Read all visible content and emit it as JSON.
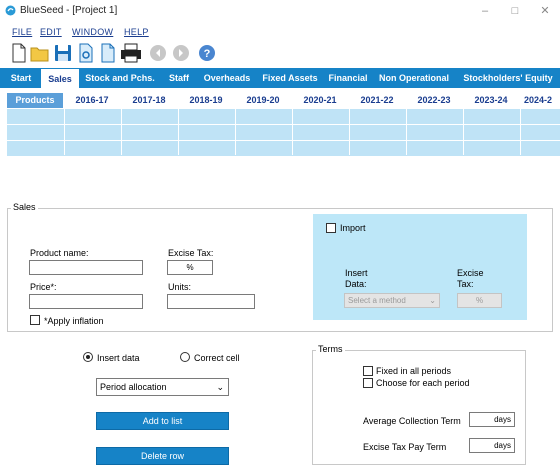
{
  "window": {
    "title": "BlueSeed - [Project 1]"
  },
  "menu": {
    "items": [
      "FILE",
      "EDIT",
      "WINDOW",
      "HELP"
    ]
  },
  "toolbar": {
    "icons": [
      "new-file-icon",
      "open-folder-icon",
      "save-icon",
      "settings-file-icon",
      "document-icon",
      "print-icon",
      "back-icon",
      "forward-icon",
      "help-icon"
    ]
  },
  "tabs": [
    "Start",
    "Sales",
    "Stock and Pchs.",
    "Staff",
    "Overheads",
    "Fixed Assets",
    "Financial",
    "Non Operational",
    "Stockholders' Equity"
  ],
  "active_tab": "Sales",
  "grid": {
    "columns": [
      "Products",
      "2016-17",
      "2017-18",
      "2018-19",
      "2019-20",
      "2020-21",
      "2021-22",
      "2022-23",
      "2023-24",
      "2024-2"
    ]
  },
  "sales": {
    "legend": "Sales",
    "product_name_label": "Product name:",
    "excise_tax_label": "Excise Tax:",
    "excise_tax_unit": "%",
    "price_label": "Price*:",
    "units_label": "Units:",
    "apply_inflation_label": "*Apply inflation",
    "import_label": "Import",
    "insert_data_label": "Insert\nData:",
    "insert_data_line1": "Insert",
    "insert_data_line2": "Data:",
    "import_excise_line1": "Excise",
    "import_excise_line2": "Tax:",
    "method_placeholder": "Select a method",
    "import_excise_unit": "%"
  },
  "mode": {
    "insert_data_label": "Insert data",
    "correct_cell_label": "Correct cell",
    "selected": "Insert data",
    "period_select_value": "Period allocation",
    "add_button": "Add to list",
    "delete_button": "Delete row"
  },
  "terms": {
    "legend": "Terms",
    "fixed_label": "Fixed in all periods",
    "choose_label": "Choose for each period",
    "collection_label": "Average Collection Term",
    "collection_unit": "days",
    "excise_pay_label": "Excise Tax Pay Term",
    "excise_pay_unit": "days"
  },
  "colors": {
    "accent": "#1683c7",
    "grid_blue": "#bfe3f6",
    "import_bg": "#bde7f8",
    "menu_text": "#1a3d8f"
  }
}
